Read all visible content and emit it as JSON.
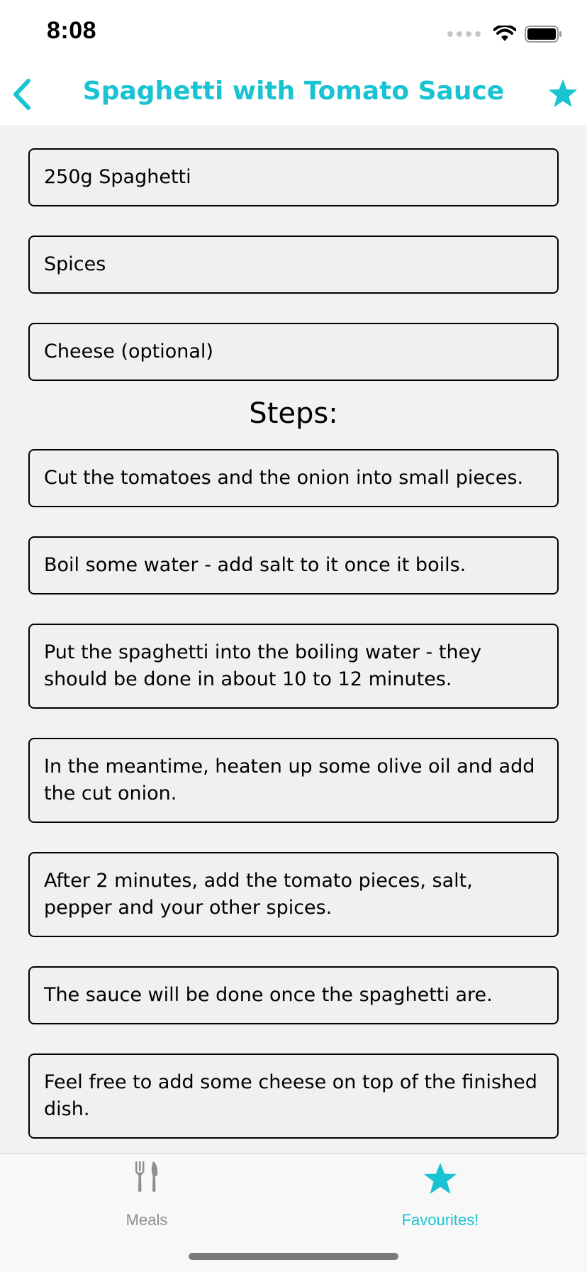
{
  "status": {
    "time": "8:08"
  },
  "nav": {
    "title": "Spaghetti with Tomato Sauce",
    "back_icon": "chevron-left-icon",
    "favorite_icon": "star-icon"
  },
  "ingredients": [
    "250g Spaghetti",
    "Spices",
    "Cheese (optional)"
  ],
  "steps_title": "Steps:",
  "steps": [
    "Cut the tomatoes and the onion into small pieces.",
    "Boil some water - add salt to it once it boils.",
    "Put the spaghetti into the boiling water - they should be done in about 10 to 12 minutes.",
    "In the meantime, heaten up some olive oil and add the cut onion.",
    "After 2 minutes, add the tomato pieces, salt, pepper and your other spices.",
    "The sauce will be done once the spaghetti are.",
    "Feel free to add some cheese on top of the finished dish."
  ],
  "tabs": [
    {
      "label": "Meals",
      "icon": "fork-knife-icon",
      "active": false
    },
    {
      "label": "Favourites!",
      "icon": "star-icon",
      "active": true
    }
  ],
  "colors": {
    "accent": "#19c3d1",
    "inactive": "#8e8e93",
    "background": "#f2f2f2"
  }
}
